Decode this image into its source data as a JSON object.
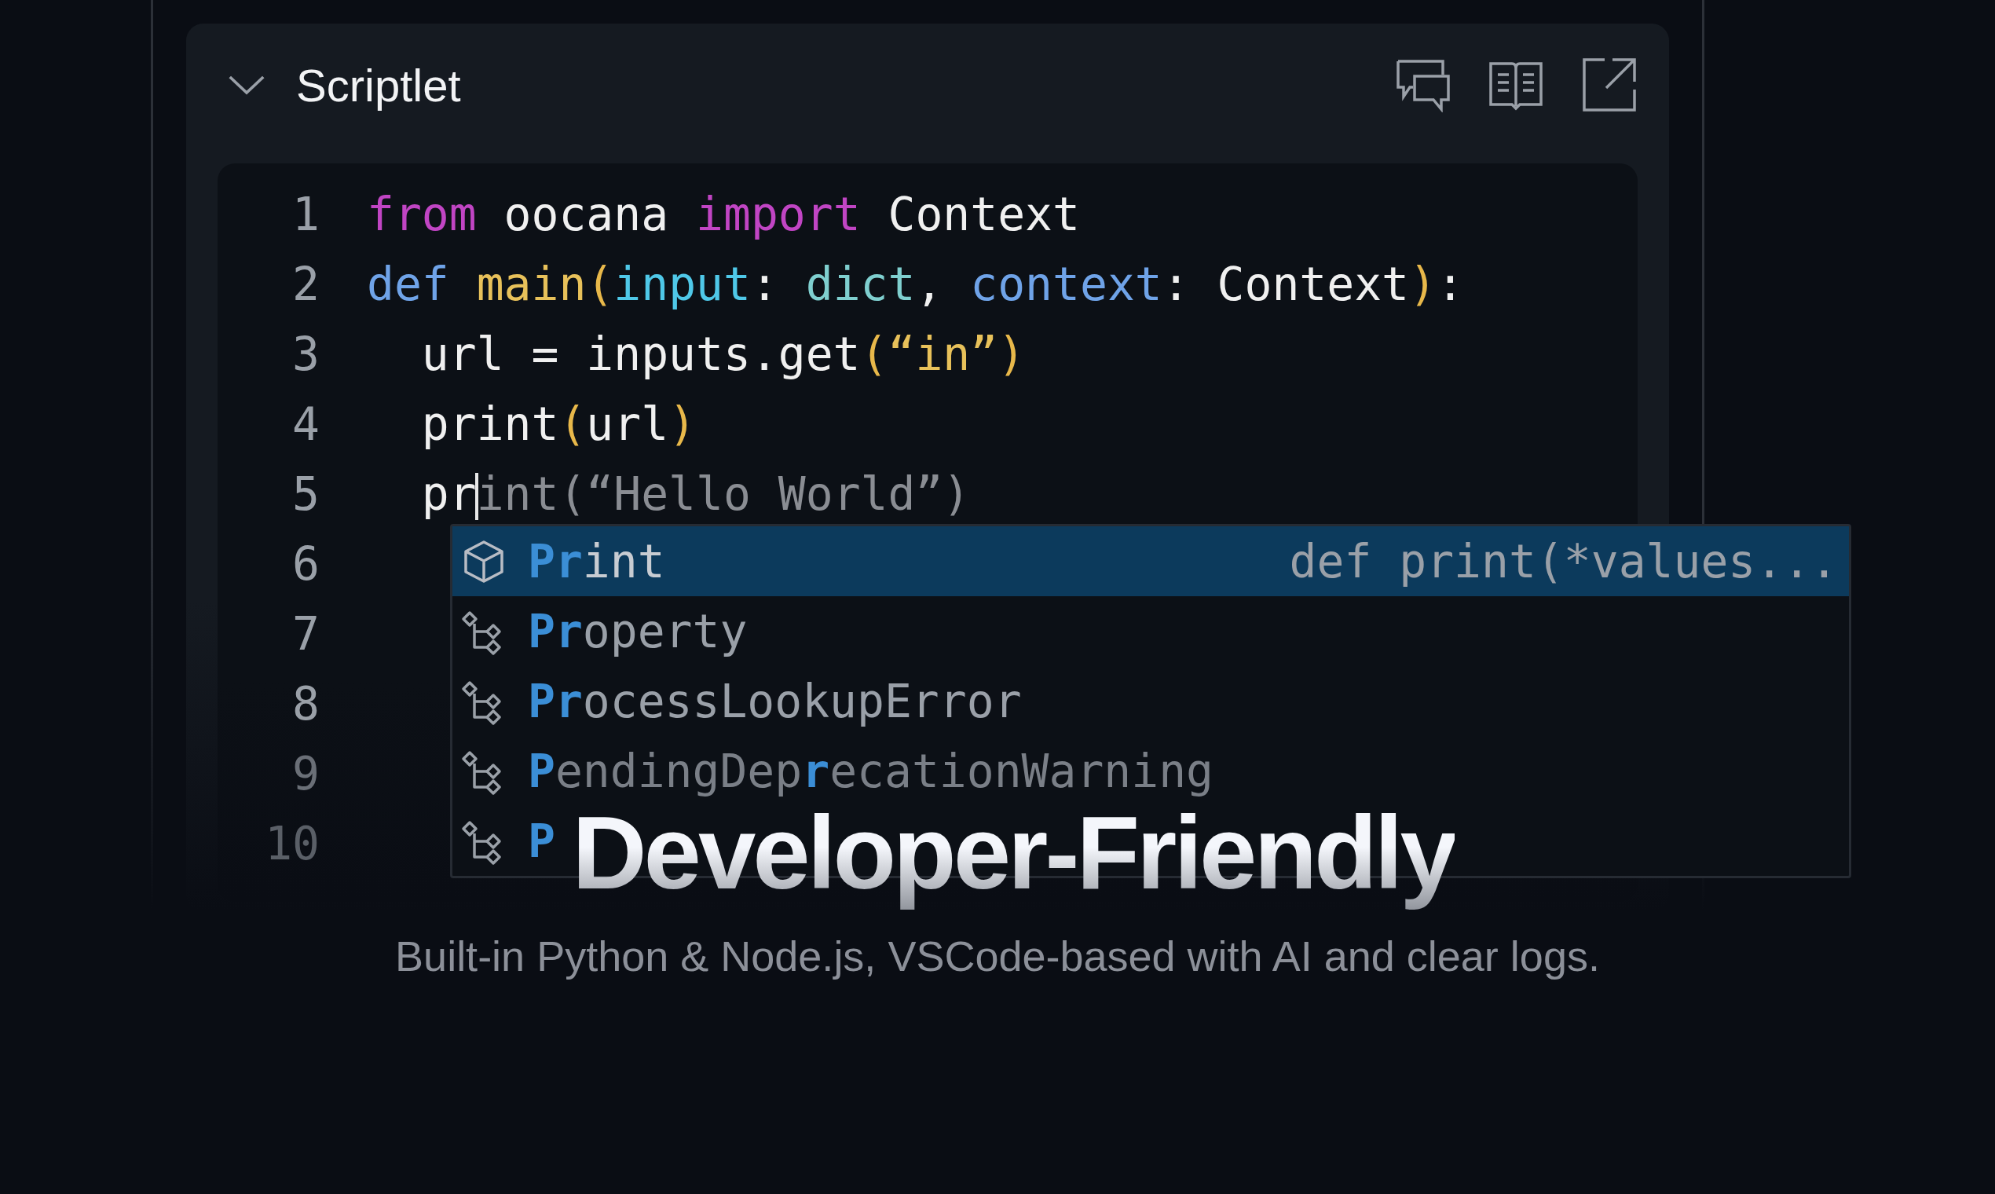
{
  "panel": {
    "title": "Scriptlet",
    "expanded": true
  },
  "editor": {
    "lines": [
      {
        "number": "1",
        "tokens": [
          {
            "text": "from",
            "kind": "keyword"
          },
          {
            "text": " oocana ",
            "kind": "plain"
          },
          {
            "text": "import",
            "kind": "keyword"
          },
          {
            "text": " Context",
            "kind": "plain"
          }
        ]
      },
      {
        "number": "2",
        "tokens": [
          {
            "text": "def ",
            "kind": "storage"
          },
          {
            "text": "main",
            "kind": "function"
          },
          {
            "text": "(",
            "kind": "bracket"
          },
          {
            "text": "input",
            "kind": "param"
          },
          {
            "text": ": ",
            "kind": "plain"
          },
          {
            "text": "dict",
            "kind": "type"
          },
          {
            "text": ", ",
            "kind": "plain"
          },
          {
            "text": "context",
            "kind": "storage"
          },
          {
            "text": ": Context",
            "kind": "plain"
          },
          {
            "text": ")",
            "kind": "bracket"
          },
          {
            "text": ":",
            "kind": "plain"
          }
        ]
      },
      {
        "number": "3",
        "tokens": [
          {
            "text": "  url = inputs.get",
            "kind": "plain"
          },
          {
            "text": "(",
            "kind": "bracket"
          },
          {
            "text": "“in”",
            "kind": "string"
          },
          {
            "text": ")",
            "kind": "bracket"
          }
        ]
      },
      {
        "number": "4",
        "tokens": [
          {
            "text": "  print",
            "kind": "plain"
          },
          {
            "text": "(",
            "kind": "bracket"
          },
          {
            "text": "url",
            "kind": "plain"
          },
          {
            "text": ")",
            "kind": "bracket"
          }
        ]
      },
      {
        "number": "5",
        "tokens": [
          {
            "text": "  pr",
            "kind": "plain"
          },
          {
            "text": "int(“Hello World”)",
            "kind": "ghost",
            "cursor_before": true
          }
        ]
      },
      {
        "number": "6"
      },
      {
        "number": "7"
      },
      {
        "number": "8"
      },
      {
        "number": "9"
      },
      {
        "number": "10"
      }
    ]
  },
  "suggestions": [
    {
      "kind": "method",
      "selected": true,
      "label": [
        {
          "text": "Pr",
          "match": true
        },
        {
          "text": "int",
          "match": false
        }
      ],
      "detail": "def print(*values..."
    },
    {
      "kind": "class",
      "selected": false,
      "label": [
        {
          "text": "Pr",
          "match": true
        },
        {
          "text": "operty",
          "match": false
        }
      ]
    },
    {
      "kind": "class",
      "selected": false,
      "label": [
        {
          "text": "Pr",
          "match": true
        },
        {
          "text": "ocessLookupError",
          "match": false
        }
      ]
    },
    {
      "kind": "class",
      "selected": false,
      "label": [
        {
          "text": "P",
          "match": true
        },
        {
          "text": "endingDep",
          "match": false
        },
        {
          "text": "r",
          "match": true
        },
        {
          "text": "ecationWarning",
          "match": false
        }
      ]
    },
    {
      "kind": "class",
      "selected": false,
      "label": [
        {
          "text": "P",
          "match": true
        }
      ]
    }
  ],
  "headline": "Developer-Friendly",
  "subtitle": "Built-in Python & Node.js, VSCode-based with AI and clear logs."
}
